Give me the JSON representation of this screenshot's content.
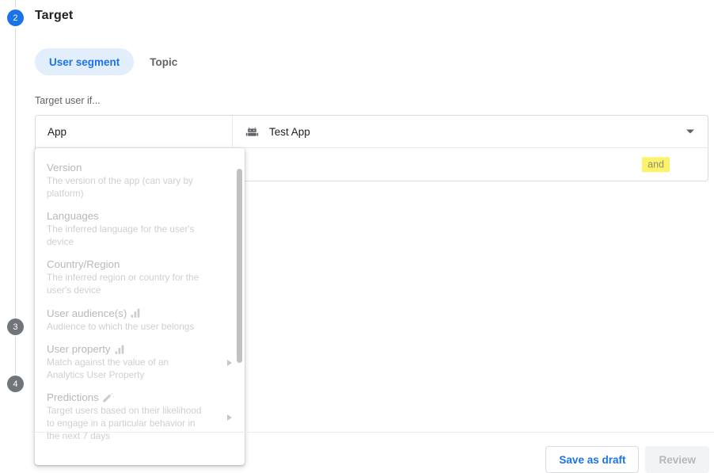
{
  "stepper": {
    "current": {
      "number": "2",
      "color": "#1a73e8"
    },
    "upcoming": [
      {
        "number": "3"
      },
      {
        "number": "4"
      }
    ]
  },
  "header": {
    "title": "Target"
  },
  "tabs": [
    {
      "label": "User segment",
      "active": true
    },
    {
      "label": "Topic",
      "active": false
    }
  ],
  "target": {
    "label": "Target user if...",
    "condition": {
      "field_label": "App",
      "app_icon": "android-icon",
      "app_value": "Test App",
      "dropdown_icon": "chevron-down-icon",
      "operator_chip": "and"
    }
  },
  "dropdown": {
    "items": [
      {
        "title": "Version",
        "description": "The version of the app (can vary by platform)",
        "icon": null,
        "has_submenu": false
      },
      {
        "title": "Languages",
        "description": "The inferred language for the user's device",
        "icon": null,
        "has_submenu": false
      },
      {
        "title": "Country/Region",
        "description": "The inferred region or country for the user's device",
        "icon": null,
        "has_submenu": false
      },
      {
        "title": "User audience(s)",
        "description": "Audience to which the user belongs",
        "icon": "analytics-bars-icon",
        "has_submenu": false
      },
      {
        "title": "User property",
        "description": "Match against the value of an Analytics User Property",
        "icon": "analytics-bars-icon",
        "has_submenu": true
      },
      {
        "title": "Predictions",
        "description": "Target users based on their likelihood to engage in a particular behavior in the next 7 days",
        "icon": "magic-wand-icon",
        "has_submenu": true
      }
    ],
    "scrollbar": "vertical-scrollbar"
  },
  "footer": {
    "save_draft_label": "Save as draft",
    "review_label": "Review"
  },
  "colors": {
    "accent": "#1a73e8",
    "tab_active_bg": "#e3eefc",
    "chip_highlight": "#fdf36b",
    "step_muted": "#70757a",
    "border": "#dadce0"
  }
}
